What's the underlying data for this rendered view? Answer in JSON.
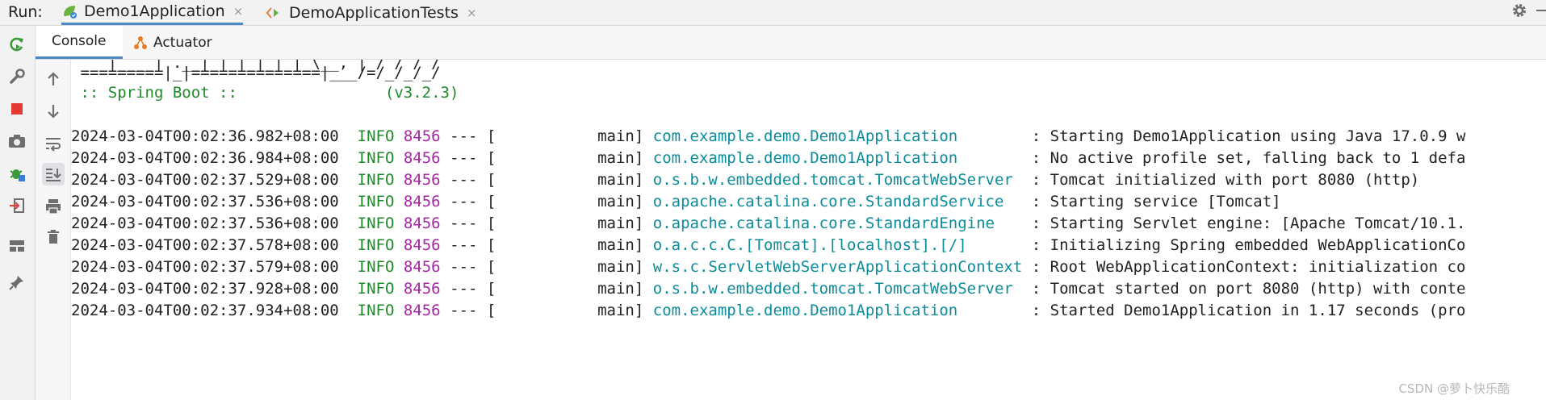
{
  "topbar": {
    "run_label": "Run:",
    "tabs": [
      {
        "label": "Demo1Application",
        "active": true
      },
      {
        "label": "DemoApplicationTests",
        "active": false
      }
    ],
    "close_glyph": "×"
  },
  "subbar": {
    "tabs": [
      {
        "label": "Console",
        "active": true
      },
      {
        "label": "Actuator",
        "active": false
      }
    ]
  },
  "console": {
    "banner": [
      "    |____| .__|_| |_|_| |_\\__, | / / / /",
      " =========|_|==============|___/=/_/_/_/",
      " :: Spring Boot ::                (v3.2.3)"
    ],
    "logs": [
      {
        "ts": "2024-03-04T00:02:36.982+08:00",
        "level": "INFO",
        "pid": "8456",
        "sep": "--- [",
        "thread": "           main]",
        "logger": "com.example.demo.Demo1Application       ",
        "msg": ": Starting Demo1Application using Java 17.0.9 w"
      },
      {
        "ts": "2024-03-04T00:02:36.984+08:00",
        "level": "INFO",
        "pid": "8456",
        "sep": "--- [",
        "thread": "           main]",
        "logger": "com.example.demo.Demo1Application       ",
        "msg": ": No active profile set, falling back to 1 defa"
      },
      {
        "ts": "2024-03-04T00:02:37.529+08:00",
        "level": "INFO",
        "pid": "8456",
        "sep": "--- [",
        "thread": "           main]",
        "logger": "o.s.b.w.embedded.tomcat.TomcatWebServer ",
        "msg": ": Tomcat initialized with port 8080 (http)"
      },
      {
        "ts": "2024-03-04T00:02:37.536+08:00",
        "level": "INFO",
        "pid": "8456",
        "sep": "--- [",
        "thread": "           main]",
        "logger": "o.apache.catalina.core.StandardService  ",
        "msg": ": Starting service [Tomcat]"
      },
      {
        "ts": "2024-03-04T00:02:37.536+08:00",
        "level": "INFO",
        "pid": "8456",
        "sep": "--- [",
        "thread": "           main]",
        "logger": "o.apache.catalina.core.StandardEngine   ",
        "msg": ": Starting Servlet engine: [Apache Tomcat/10.1."
      },
      {
        "ts": "2024-03-04T00:02:37.578+08:00",
        "level": "INFO",
        "pid": "8456",
        "sep": "--- [",
        "thread": "           main]",
        "logger": "o.a.c.c.C.[Tomcat].[localhost].[/]      ",
        "msg": ": Initializing Spring embedded WebApplicationCo"
      },
      {
        "ts": "2024-03-04T00:02:37.579+08:00",
        "level": "INFO",
        "pid": "8456",
        "sep": "--- [",
        "thread": "           main]",
        "logger": "w.s.c.ServletWebServerApplicationContext",
        "msg": ": Root WebApplicationContext: initialization co"
      },
      {
        "ts": "2024-03-04T00:02:37.928+08:00",
        "level": "INFO",
        "pid": "8456",
        "sep": "--- [",
        "thread": "           main]",
        "logger": "o.s.b.w.embedded.tomcat.TomcatWebServer ",
        "msg": ": Tomcat started on port 8080 (http) with conte"
      },
      {
        "ts": "2024-03-04T00:02:37.934+08:00",
        "level": "INFO",
        "pid": "8456",
        "sep": "--- [",
        "thread": "           main]",
        "logger": "com.example.demo.Demo1Application       ",
        "msg": ": Started Demo1Application in 1.17 seconds (pro"
      }
    ]
  },
  "watermark": "CSDN @萝卜快乐酷",
  "colors": {
    "accent": "#4a88c7",
    "green": "#1f8a2a",
    "pid": "#a626a4",
    "logger": "#0a8c9a",
    "stop": "#e53935"
  },
  "icons": [
    "rerun-icon",
    "wrench-icon",
    "stop-icon",
    "camera-icon",
    "debug-icon",
    "login-icon",
    "layout-icon",
    "pin-icon",
    "arrow-up-icon",
    "arrow-down-icon",
    "soft-wrap-icon",
    "scroll-to-end-icon",
    "print-icon",
    "trash-icon",
    "gear-icon",
    "minimize-icon"
  ]
}
